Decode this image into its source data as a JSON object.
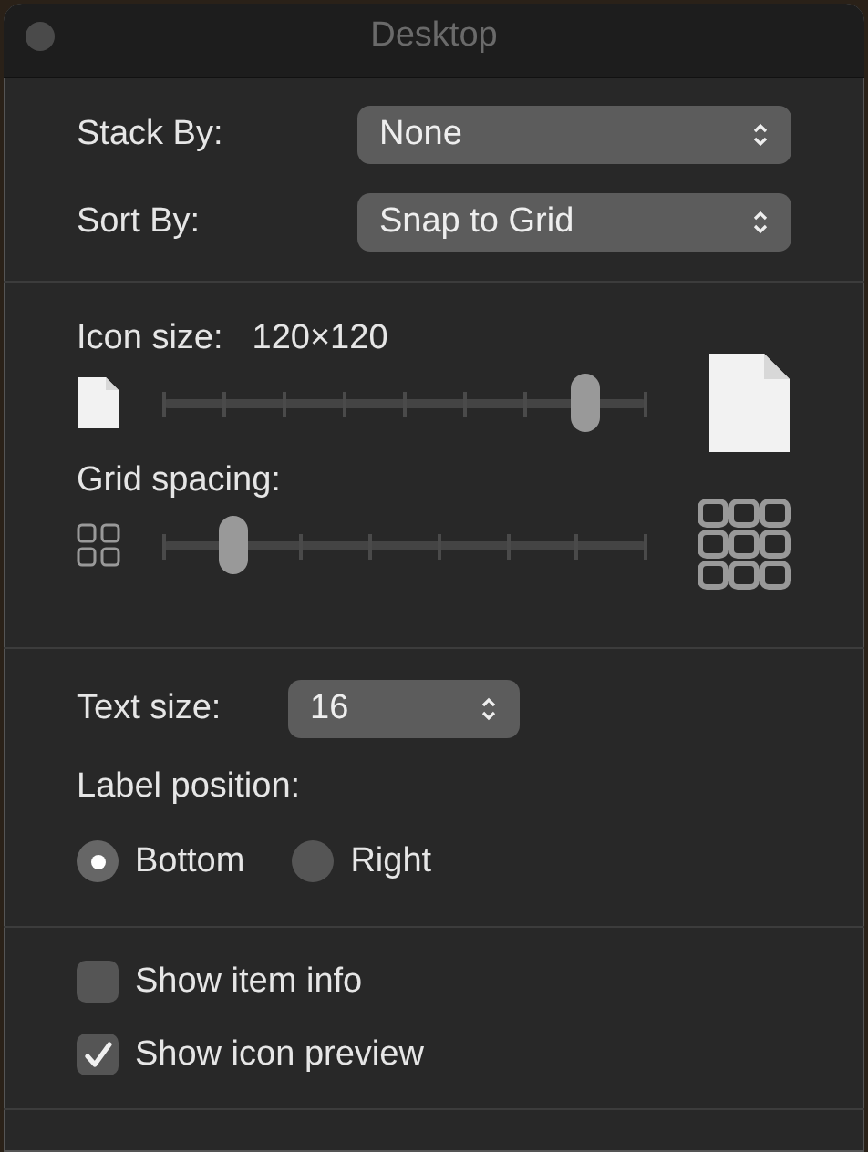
{
  "window": {
    "title": "Desktop"
  },
  "popups": [
    {
      "label": "Stack By:",
      "value": "None"
    },
    {
      "label": "Sort By:",
      "value": "Snap to Grid"
    }
  ],
  "icon_size": {
    "label": "Icon size:",
    "reading": "120×120",
    "level": 0.875
  },
  "grid_spacing": {
    "label": "Grid spacing:",
    "level": 0.143
  },
  "text_size": {
    "label": "Text size:",
    "value": "16"
  },
  "label_position": {
    "label": "Label position:",
    "options": [
      {
        "label": "Bottom",
        "selected": true
      },
      {
        "label": "Right",
        "selected": false
      }
    ]
  },
  "checkboxes": [
    {
      "label": "Show item info",
      "checked": false
    },
    {
      "label": "Show icon preview",
      "checked": true
    }
  ]
}
